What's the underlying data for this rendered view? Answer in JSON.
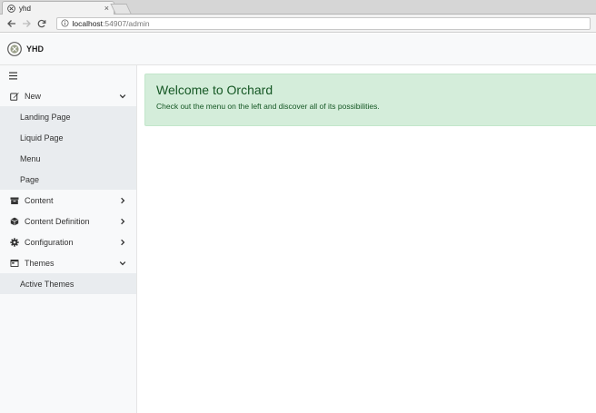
{
  "browser": {
    "tab_title": "yhd",
    "tab_close": "×",
    "url_host": "localhost",
    "url_path": ":54907/admin"
  },
  "app": {
    "brand_name": "YHD"
  },
  "sidebar": {
    "hamburger": "≡",
    "items": [
      {
        "label": "New",
        "icon": "pencil-square-icon",
        "chevron": "down",
        "children": [
          "Landing Page",
          "Liquid Page",
          "Menu",
          "Page"
        ]
      },
      {
        "label": "Content",
        "icon": "archive-icon",
        "chevron": "right"
      },
      {
        "label": "Content Definition",
        "icon": "cube-icon",
        "chevron": "right"
      },
      {
        "label": "Configuration",
        "icon": "cog-icon",
        "chevron": "right"
      },
      {
        "label": "Themes",
        "icon": "window-icon",
        "chevron": "down",
        "children": [
          "Active Themes"
        ]
      }
    ]
  },
  "main": {
    "alert_title": "Welcome to Orchard",
    "alert_text": "Check out the menu on the left and discover all of its possibilities."
  },
  "colors": {
    "alert_bg": "#d4edda",
    "alert_text": "#155724",
    "sidebar_bg": "#f8f9fa",
    "submenu_bg": "#e9ecef"
  }
}
